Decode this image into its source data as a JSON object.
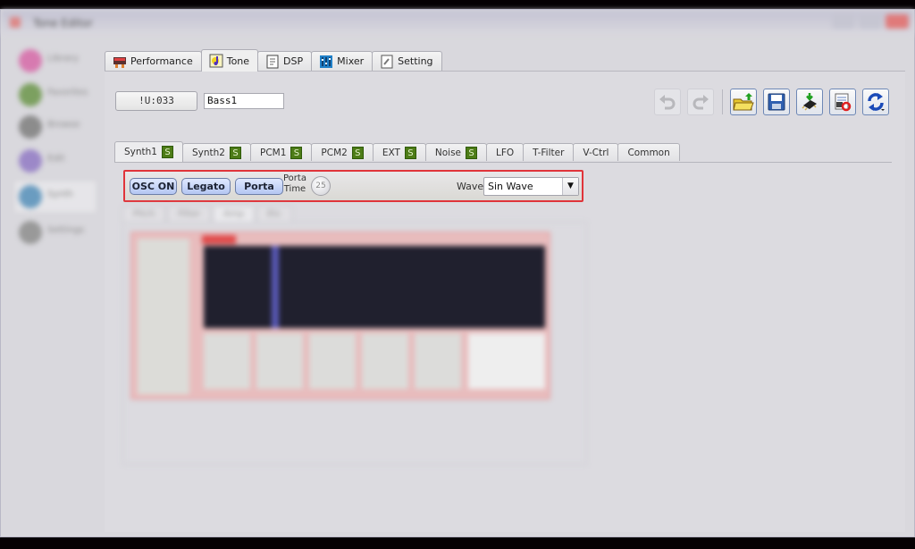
{
  "window": {
    "title": "Tone Editor",
    "controls": [
      "minimize",
      "maximize",
      "close"
    ]
  },
  "sidebar": {
    "items": [
      {
        "label": "Library",
        "icon": "library-icon",
        "color": "#d77ab0"
      },
      {
        "label": "Favorites",
        "icon": "favorites-icon",
        "color": "#7ca060"
      },
      {
        "label": "Browse",
        "icon": "browse-icon",
        "color": "#8c8c8c"
      },
      {
        "label": "Edit",
        "icon": "edit-icon",
        "color": "#9c88c8"
      },
      {
        "label": "Synth",
        "icon": "synth-icon",
        "color": "#6a9cc0"
      },
      {
        "label": "Settings",
        "icon": "settings-icon",
        "color": "#999999"
      }
    ]
  },
  "main_tabs": [
    {
      "label": "Performance",
      "icon": "performance-icon",
      "active": false
    },
    {
      "label": "Tone",
      "icon": "tone-icon",
      "active": true
    },
    {
      "label": "DSP",
      "icon": "dsp-icon",
      "active": false
    },
    {
      "label": "Mixer",
      "icon": "mixer-icon",
      "active": false
    },
    {
      "label": "Setting",
      "icon": "setting-icon",
      "active": false
    }
  ],
  "patch": {
    "number": "!U:033",
    "name": "Bass1"
  },
  "toolbar": {
    "buttons": [
      {
        "name": "undo",
        "icon": "undo-icon",
        "enabled": false
      },
      {
        "name": "redo",
        "icon": "redo-icon",
        "enabled": false
      },
      {
        "name": "open",
        "icon": "open-folder-icon",
        "enabled": true
      },
      {
        "name": "save",
        "icon": "save-icon",
        "enabled": true
      },
      {
        "name": "write",
        "icon": "write-to-device-icon",
        "enabled": true
      },
      {
        "name": "load",
        "icon": "load-from-device-icon",
        "enabled": true
      },
      {
        "name": "sync",
        "icon": "sync-icon",
        "enabled": true
      }
    ]
  },
  "sub_tabs": [
    {
      "label": "Synth1",
      "badge": "S",
      "active": true
    },
    {
      "label": "Synth2",
      "badge": "S",
      "active": false
    },
    {
      "label": "PCM1",
      "badge": "S",
      "active": false
    },
    {
      "label": "PCM2",
      "badge": "S",
      "active": false
    },
    {
      "label": "EXT",
      "badge": "S",
      "active": false
    },
    {
      "label": "Noise",
      "badge": "S",
      "active": false
    },
    {
      "label": "LFO",
      "badge": null,
      "active": false
    },
    {
      "label": "T-Filter",
      "badge": null,
      "active": false
    },
    {
      "label": "V-Ctrl",
      "badge": null,
      "active": false
    },
    {
      "label": "Common",
      "badge": null,
      "active": false
    }
  ],
  "osc": {
    "osc_on_label": "OSC ON",
    "legato_label": "Legato",
    "porta_label": "Porta",
    "porta_time_label_1": "Porta",
    "porta_time_label_2": "Time",
    "porta_time_value": "25",
    "wave_label": "Wave",
    "wave_value": "Sin Wave",
    "highlight_color": "#e0343a"
  },
  "envelope_tabs": [
    {
      "label": "Pitch",
      "active": false
    },
    {
      "label": "Filter",
      "active": false
    },
    {
      "label": "Amp",
      "active": true
    },
    {
      "label": "Etc",
      "active": false
    }
  ],
  "colors": {
    "badge_green": "#4d7c17",
    "button_blue": "#b4c6f2",
    "envelope_screen": "#20202e"
  }
}
